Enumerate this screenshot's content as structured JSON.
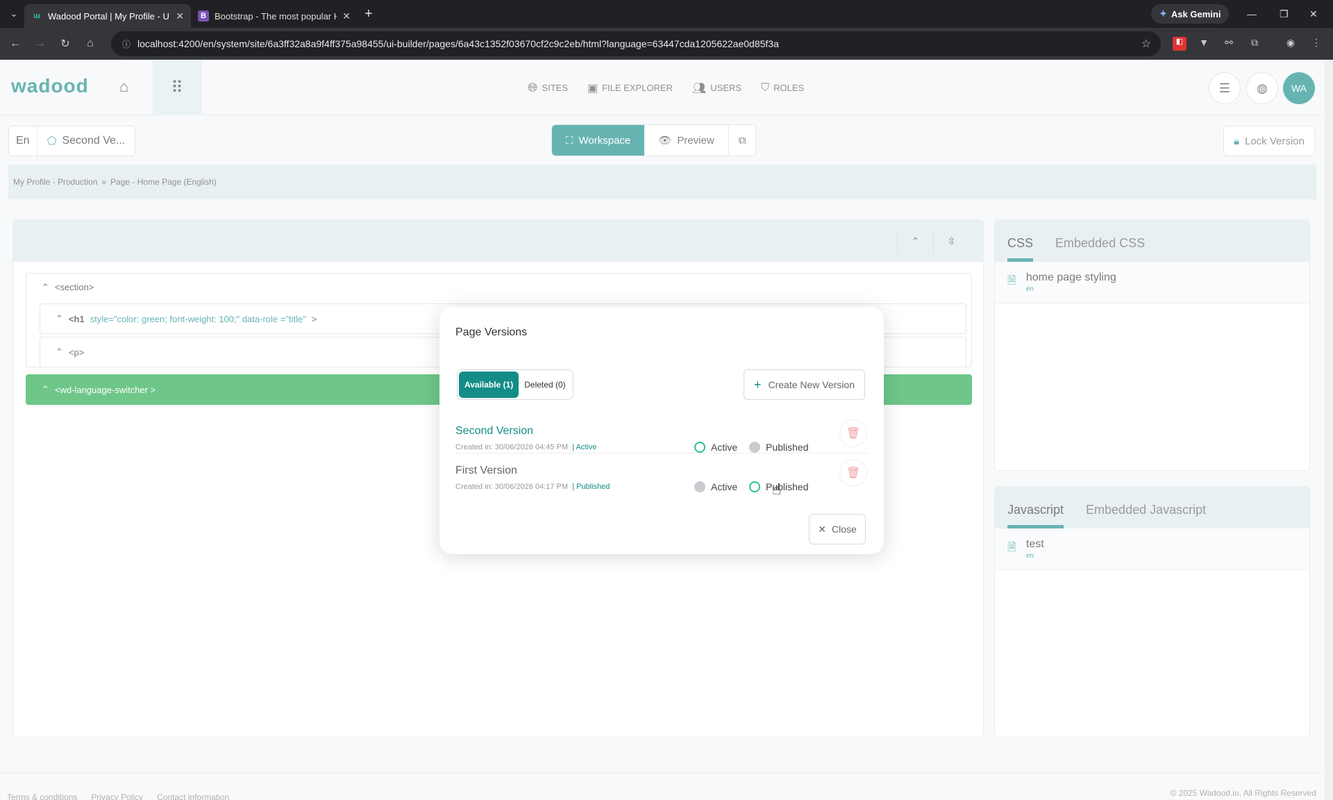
{
  "browser": {
    "tabs": [
      {
        "title": "Wadood Portal | My Profile - U",
        "active": true
      },
      {
        "title": "Bootstrap - The most popular H",
        "active": false
      }
    ],
    "ask_gemini": "Ask Gemini",
    "url": "localhost:4200/en/system/site/6a3ff32a8a9f4ff375a98455/ui-builder/pages/6a43c1352f03670cf2c9c2eb/html?language=63447cda1205622ae0d85f3a"
  },
  "header": {
    "logo": "wadood",
    "nav": [
      "SITES",
      "FILE EXPLORER",
      "USERS",
      "ROLES"
    ],
    "avatar": "WA"
  },
  "toolbar": {
    "lang": "En",
    "version": "Second Ve...",
    "workspace": "Workspace",
    "preview": "Preview",
    "lock": "Lock Version"
  },
  "breadcrumb": [
    "My Profile - Production",
    "»",
    "Page - Home Page (English)"
  ],
  "tree": {
    "section": "<section>",
    "h1_tag": "<h1",
    "h1_attrs": "style=\"color: green; font-weight: 100;\"   data-role =\"title\"",
    "h1_close": ">",
    "p": "<p>",
    "switcher": "<wd-language-switcher >"
  },
  "css_panel": {
    "tabs": [
      "CSS",
      "Embedded CSS"
    ],
    "file": {
      "name": "home page styling",
      "lang": "en"
    }
  },
  "js_panel": {
    "tabs": [
      "Javascript",
      "Embedded Javascript"
    ],
    "file": {
      "name": "test",
      "lang": "en"
    }
  },
  "modal": {
    "title": "Page Versions",
    "tab_available": "Available (1)",
    "tab_deleted": "Deleted (0)",
    "create": "Create New Version",
    "versions": [
      {
        "name": "Second Version",
        "meta": "Created in: 30/06/2026 04:45 PM",
        "status": "| Active",
        "active_label": "Active",
        "published_label": "Published"
      },
      {
        "name": "First Version",
        "meta": "Created in: 30/06/2026 04:17 PM",
        "status": "| Published",
        "active_label": "Active",
        "published_label": "Published"
      }
    ],
    "close": "Close"
  },
  "footer": {
    "links": [
      "Terms & conditions",
      "Privacy Policy",
      "Contact information"
    ],
    "copyright": "© 2025 Wadood.io, All Rights Reserved"
  },
  "colors": {
    "brand": "#148c88",
    "green_node": "#23a84a",
    "radio_ring": "#2cc28a"
  }
}
